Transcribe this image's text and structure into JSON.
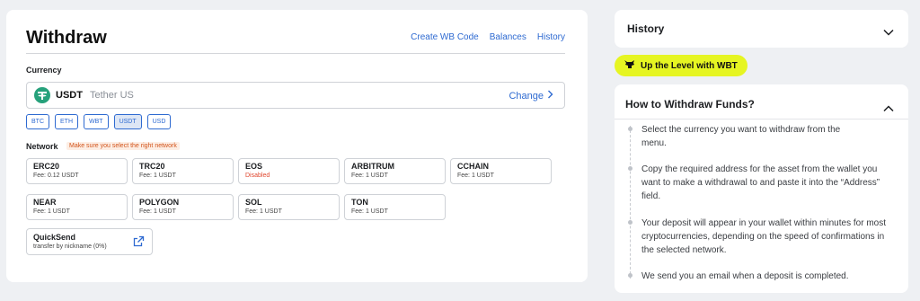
{
  "header": {
    "title": "Withdraw",
    "links": [
      "Create WB Code",
      "Balances",
      "History"
    ]
  },
  "currency": {
    "label": "Currency",
    "code": "USDT",
    "name": "Tether US",
    "change_label": "Change",
    "chips": [
      "BTC",
      "ETH",
      "WBT",
      "USDT",
      "USD"
    ],
    "selected_chip": "USDT"
  },
  "network": {
    "label": "Network",
    "warning": "Make sure you select the right network",
    "items": [
      {
        "name": "ERC20",
        "fee": "Fee: 0.12 USDT"
      },
      {
        "name": "TRC20",
        "fee": "Fee: 1 USDT"
      },
      {
        "name": "EOS",
        "fee": "Disabled"
      },
      {
        "name": "ARBITRUM",
        "fee": "Fee: 1 USDT"
      },
      {
        "name": "CCHAIN",
        "fee": "Fee: 1 USDT"
      },
      {
        "name": "NEAR",
        "fee": "Fee: 1 USDT"
      },
      {
        "name": "POLYGON",
        "fee": "Fee: 1 USDT"
      },
      {
        "name": "SOL",
        "fee": "Fee: 1 USDT"
      },
      {
        "name": "TON",
        "fee": "Fee: 1 USDT"
      }
    ],
    "quicksend": {
      "title": "QuickSend",
      "subtitle": "transfer by nickname (0%)"
    }
  },
  "sidebar": {
    "history_label": "History",
    "promo_label": "Up the Level with WBT",
    "howto": {
      "title": "How to Withdraw Funds?",
      "steps": [
        "Select the currency you want to withdraw from the menu.",
        "Copy the required address for the asset from the wallet you want to make a withdrawal to and paste it into the “Address” field.",
        "Your deposit will appear in your wallet within minutes for most cryptocurrencies, depending on the speed of confirmations in the selected network.",
        "We send you an email when a deposit is completed."
      ]
    }
  },
  "colors": {
    "accent": "#2e6ad1",
    "promo": "#e6f522",
    "warning": "#d2531a",
    "disabled": "#e0472e",
    "usdt": "#26a17b"
  },
  "icons": {
    "usdt": "tether-icon",
    "change": "chevron-right-icon",
    "external": "external-link-icon",
    "history": "chevron-down-icon",
    "howto": "chevron-up-icon",
    "promo": "wbt-bull-icon"
  }
}
